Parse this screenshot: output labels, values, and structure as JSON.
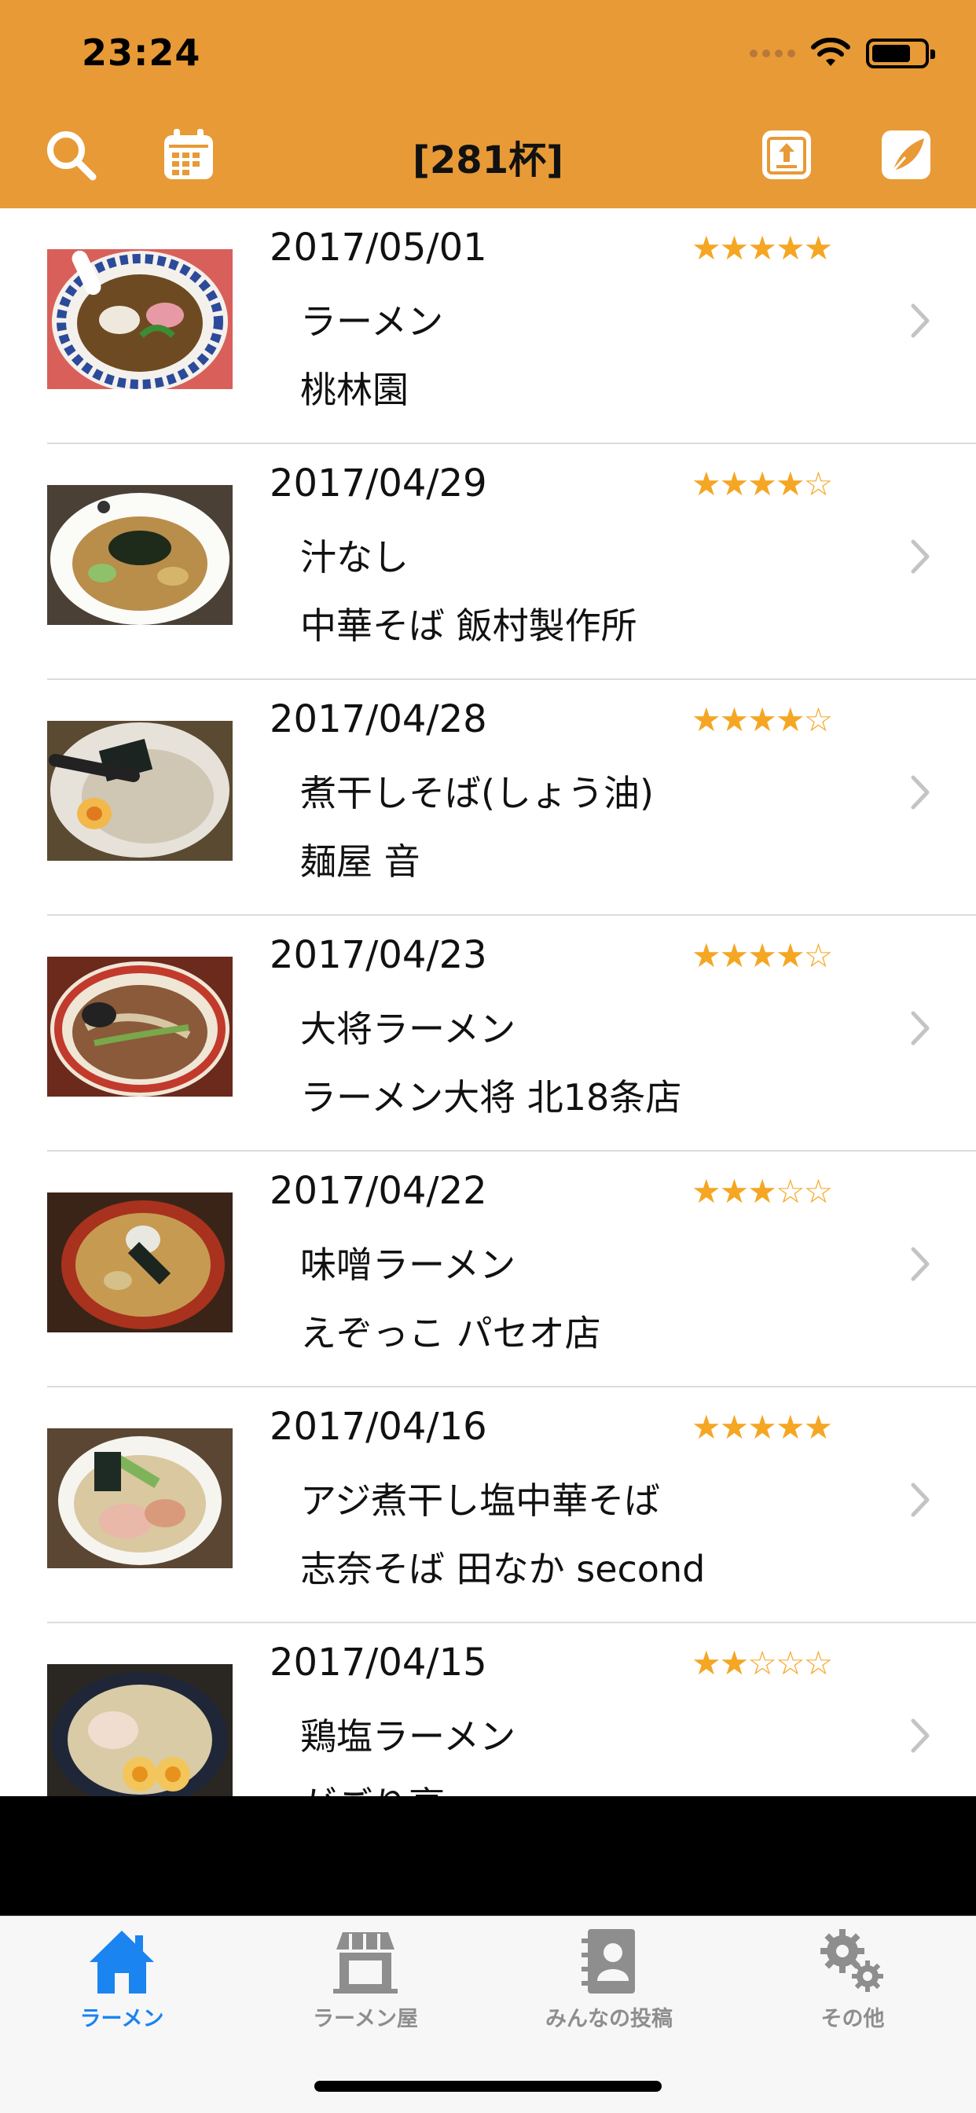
{
  "status_bar": {
    "time": "23:24"
  },
  "nav": {
    "title": "[281杯]"
  },
  "entries": [
    {
      "date": "2017/05/01",
      "rating": 5,
      "stars": "★★★★★",
      "dish": "ラーメン",
      "shop": "桃林園"
    },
    {
      "date": "2017/04/29",
      "rating": 4,
      "stars": "★★★★☆",
      "dish": "汁なし",
      "shop": "中華そば 飯村製作所"
    },
    {
      "date": "2017/04/28",
      "rating": 4,
      "stars": "★★★★☆",
      "dish": "煮干しそば(しょう油)",
      "shop": "麺屋 音"
    },
    {
      "date": "2017/04/23",
      "rating": 4,
      "stars": "★★★★☆",
      "dish": "大将ラーメン",
      "shop": "ラーメン大将 北18条店"
    },
    {
      "date": "2017/04/22",
      "rating": 3,
      "stars": "★★★☆☆",
      "dish": "味噌ラーメン",
      "shop": "えぞっこ パセオ店"
    },
    {
      "date": "2017/04/16",
      "rating": 5,
      "stars": "★★★★★",
      "dish": "アジ煮干し塩中華そば",
      "shop": "志奈そば 田なか second"
    },
    {
      "date": "2017/04/15",
      "rating": 2,
      "stars": "★★☆☆☆",
      "dish": "鶏塩ラーメン",
      "shop": "がごり亭"
    }
  ],
  "tabs": [
    {
      "label": "ラーメン",
      "icon": "home-icon",
      "active": true
    },
    {
      "label": "ラーメン屋",
      "icon": "shop-icon",
      "active": false
    },
    {
      "label": "みんなの投稿",
      "icon": "contacts-book-icon",
      "active": false
    },
    {
      "label": "その他",
      "icon": "gears-icon",
      "active": false
    }
  ],
  "colors": {
    "header": "#E89A36",
    "star": "#F5A623",
    "active_tab": "#1A84F0",
    "inactive_tab": "#8E8E8E"
  }
}
